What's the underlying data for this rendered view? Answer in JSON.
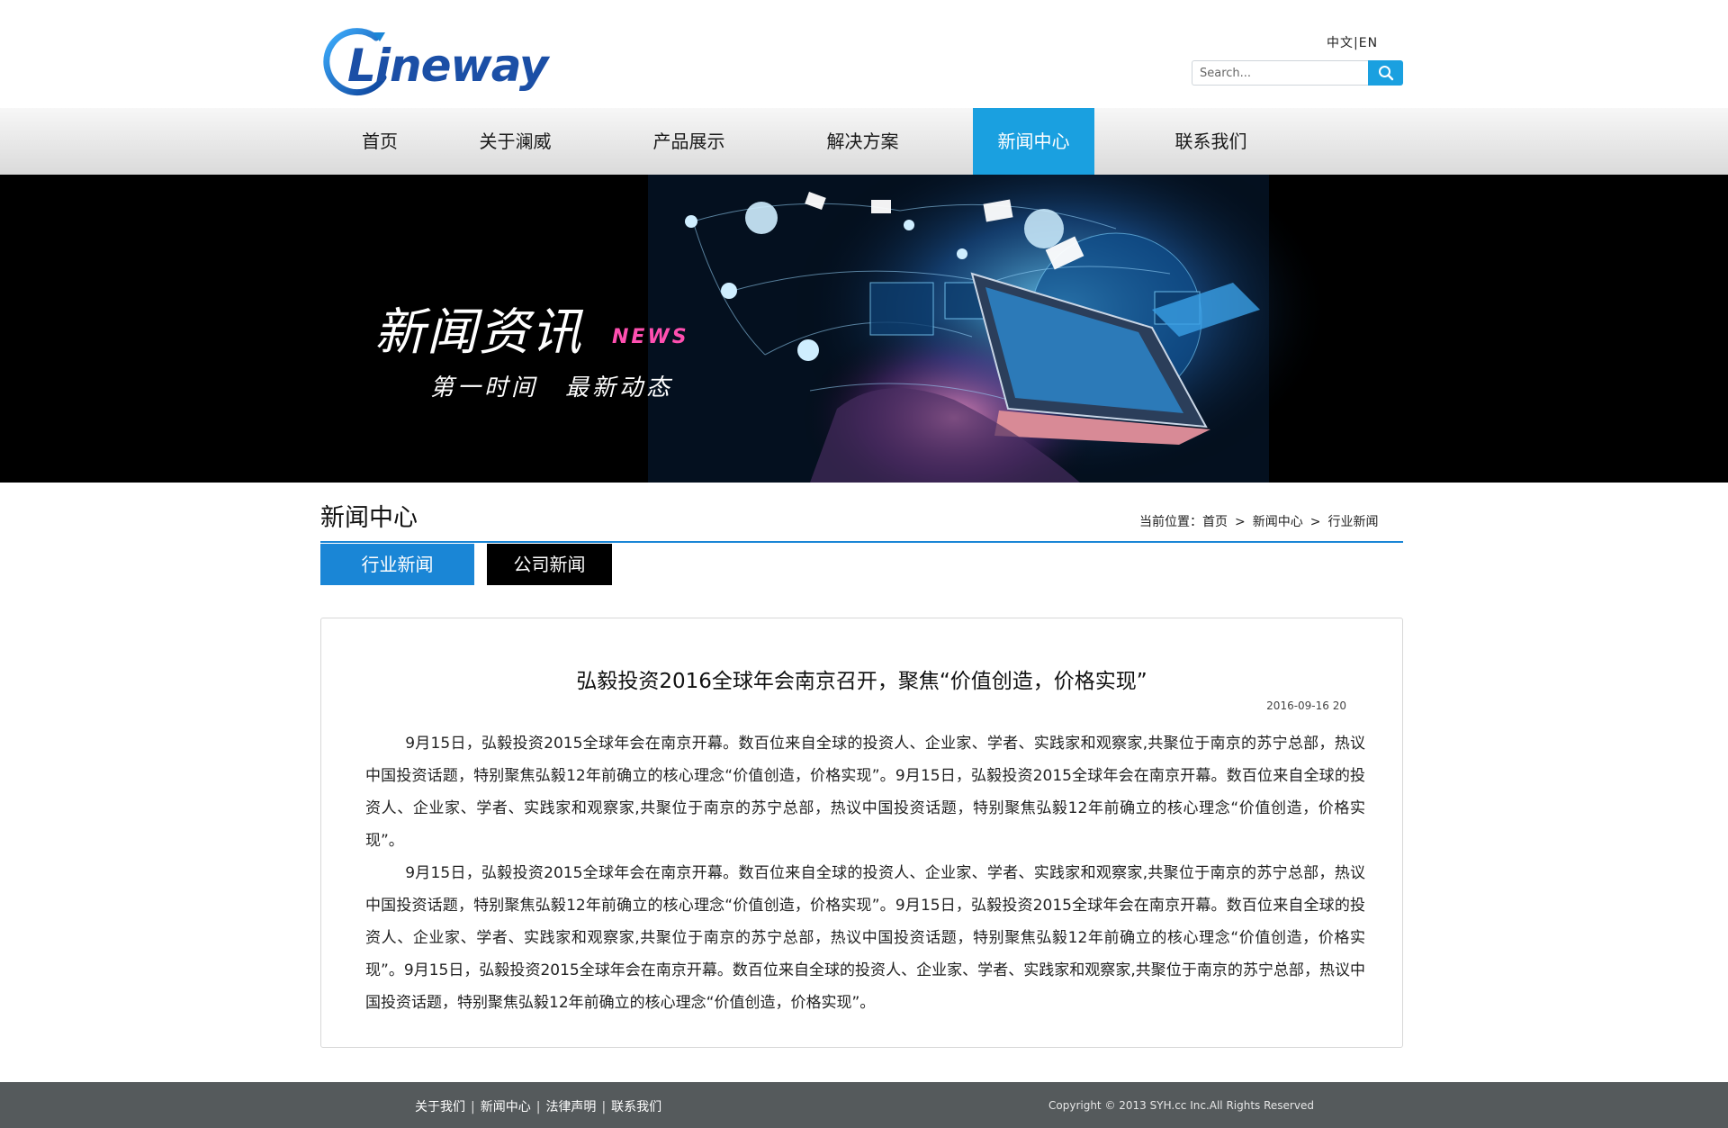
{
  "header": {
    "logo_text": "Lineway",
    "lang_zh": "中文",
    "lang_sep": "|",
    "lang_en": "EN",
    "search_placeholder": "Search..."
  },
  "nav": {
    "items": [
      {
        "label": "首页"
      },
      {
        "label": "关于澜威"
      },
      {
        "label": "产品展示"
      },
      {
        "label": "解决方案"
      },
      {
        "label": "新闻中心",
        "active": true
      },
      {
        "label": "联系我们"
      }
    ]
  },
  "banner": {
    "title": "新闻资讯",
    "title_en": "NEWS",
    "subtitle": "第一时间　最新动态"
  },
  "main": {
    "page_title": "新闻中心",
    "breadcrumb": {
      "prefix": "当前位置：",
      "home": "首页",
      "sep": ">",
      "section": "新闻中心",
      "current": "行业新闻"
    },
    "tabs": [
      {
        "label": "行业新闻",
        "active": true
      },
      {
        "label": "公司新闻",
        "active": false
      }
    ],
    "article": {
      "title": "弘毅投资2016全球年会南京召开，聚焦“价值创造，价格实现”",
      "date": "2016-09-16 20",
      "paragraphs": [
        "9月15日，弘毅投资2015全球年会在南京开幕。数百位来自全球的投资人、企业家、学者、实践家和观察家,共聚位于南京的苏宁总部，热议中国投资话题，特别聚焦弘毅12年前确立的核心理念“价值创造，价格实现”。9月15日，弘毅投资2015全球年会在南京开幕。数百位来自全球的投资人、企业家、学者、实践家和观察家,共聚位于南京的苏宁总部，热议中国投资话题，特别聚焦弘毅12年前确立的核心理念“价值创造，价格实现”。",
        "9月15日，弘毅投资2015全球年会在南京开幕。数百位来自全球的投资人、企业家、学者、实践家和观察家,共聚位于南京的苏宁总部，热议中国投资话题，特别聚焦弘毅12年前确立的核心理念“价值创造，价格实现”。9月15日，弘毅投资2015全球年会在南京开幕。数百位来自全球的投资人、企业家、学者、实践家和观察家,共聚位于南京的苏宁总部，热议中国投资话题，特别聚焦弘毅12年前确立的核心理念“价值创造，价格实现”。9月15日，弘毅投资2015全球年会在南京开幕。数百位来自全球的投资人、企业家、学者、实践家和观察家,共聚位于南京的苏宁总部，热议中国投资话题，特别聚焦弘毅12年前确立的核心理念“价值创造，价格实现”。"
      ]
    }
  },
  "footer": {
    "links": [
      "关于我们",
      "新闻中心",
      "法律声明",
      "联系我们"
    ],
    "sep": "|",
    "copyright": "Copyright © 2013 SYH.cc Inc.All Rights Reserved"
  },
  "colors": {
    "accent": "#1aa0e0",
    "tab_blue": "#1a86d6",
    "footer_bg": "#555a5c",
    "banner_pink": "#ff4fb0"
  }
}
